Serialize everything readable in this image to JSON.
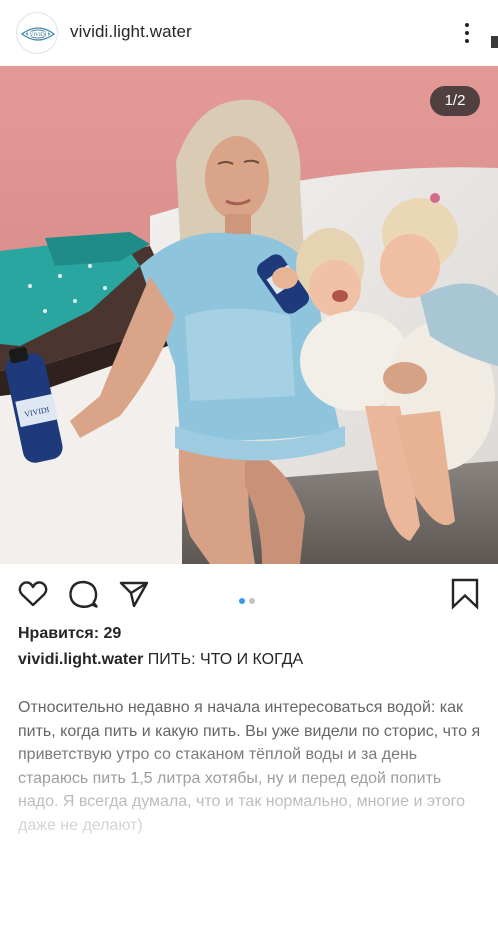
{
  "post": {
    "username": "vividi.light.water",
    "avatar_logo_text": "VIVIDI",
    "image_counter": "1/2",
    "likes_text": "Нравится: 29",
    "caption_user": "vividi.light.water",
    "caption_title": " ПИТЬ: ЧТО И КОГДА",
    "body": "Относительно недавно я начала интересоваться водой: как пить, когда пить и какую пить. Вы уже видели по сторис, что я приветствую утро со стаканом тёплой воды и за день стараюсь пить 1,5 литра хотябы, ну и перед едой попить надо. Я всегда думала, что и так нормально, многие и этого даже не делают)",
    "bottle_label_text": "VIVIDI"
  },
  "icons": {
    "like": "heart-icon",
    "comment": "comment-icon",
    "share": "paper-plane-icon",
    "save": "bookmark-icon",
    "more": "more-vertical-icon"
  },
  "carousel": {
    "total": 2,
    "active_index": 0
  },
  "colors": {
    "text": "#262626",
    "muted": "#666666",
    "dot_active": "#3897f0",
    "dot_inactive": "#c4c4c4",
    "wall": "#d98a8a",
    "shirt": "#8fc4dd"
  }
}
